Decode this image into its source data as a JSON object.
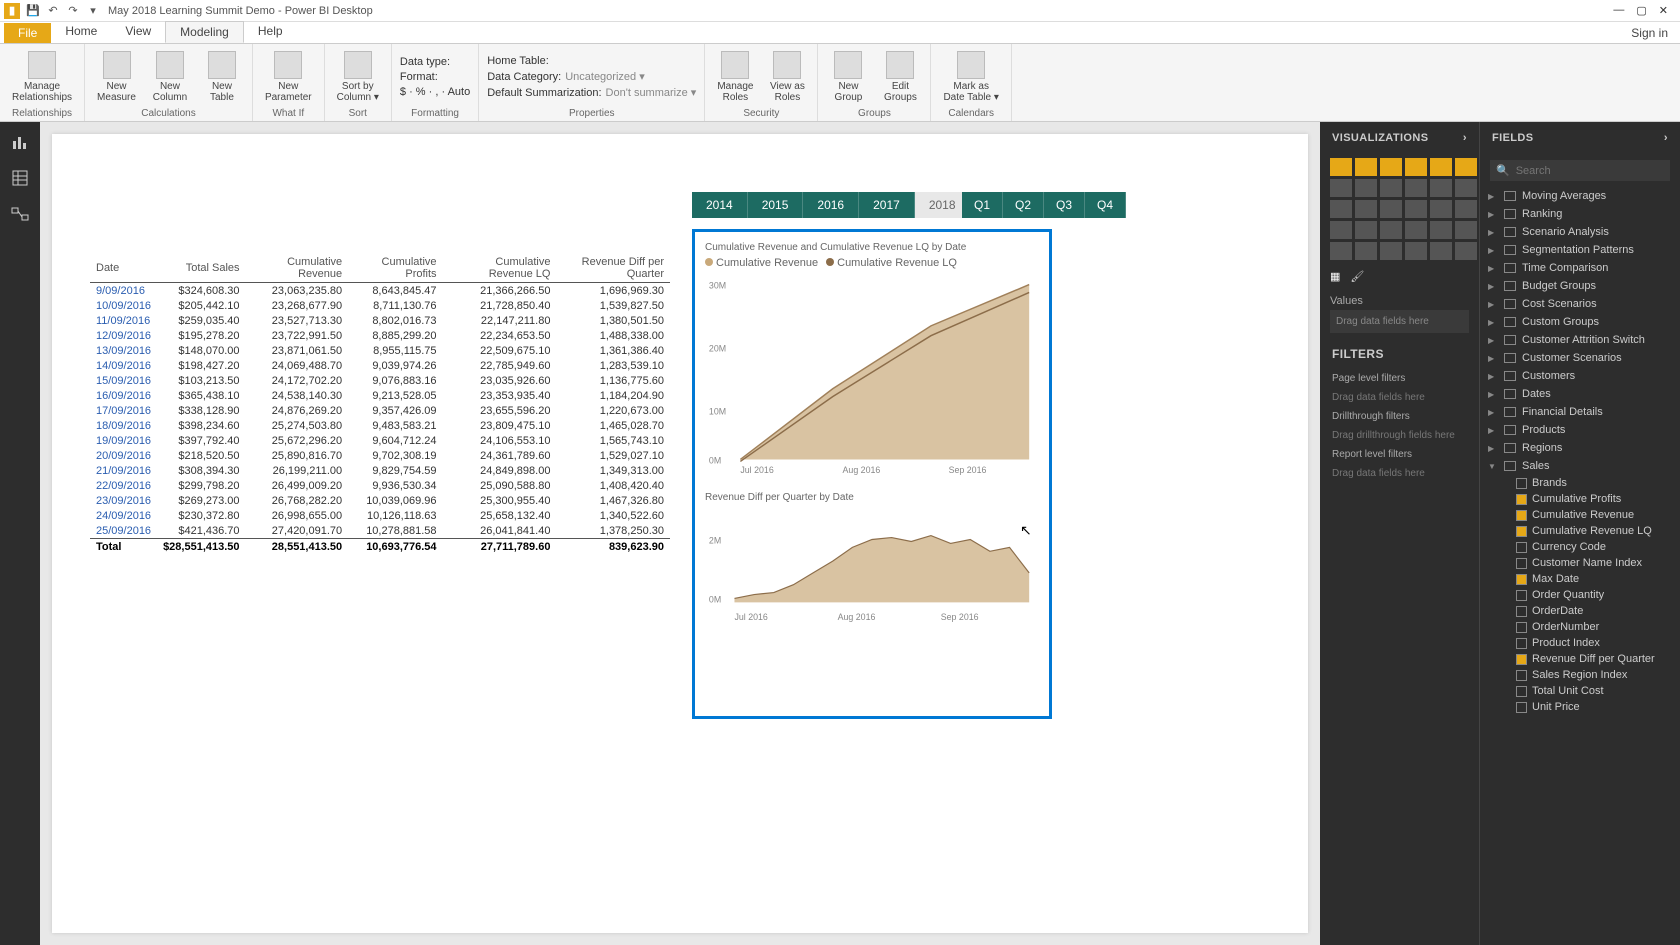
{
  "title": "May 2018 Learning Summit Demo - Power BI Desktop",
  "tabs": {
    "file": "File",
    "items": [
      "Home",
      "View",
      "Modeling",
      "Help"
    ],
    "active": "Modeling",
    "signin": "Sign in"
  },
  "ribbon": {
    "groups": [
      {
        "label": "Relationships",
        "buttons": [
          {
            "t": "Manage\nRelationships"
          }
        ]
      },
      {
        "label": "Calculations",
        "buttons": [
          {
            "t": "New\nMeasure"
          },
          {
            "t": "New\nColumn"
          },
          {
            "t": "New\nTable"
          }
        ]
      },
      {
        "label": "What If",
        "buttons": [
          {
            "t": "New\nParameter"
          }
        ]
      },
      {
        "label": "Sort",
        "buttons": [
          {
            "t": "Sort by\nColumn ▾"
          }
        ]
      },
      {
        "label": "Formatting",
        "rows": [
          {
            "l": "Data type:",
            "v": ""
          },
          {
            "l": "Format:",
            "v": ""
          },
          {
            "l2": "$ · % · , · Auto"
          }
        ]
      },
      {
        "label": "Properties",
        "rows": [
          {
            "l": "Home Table:",
            "v": ""
          },
          {
            "l": "Data Category:",
            "v": "Uncategorized ▾"
          },
          {
            "l": "Default Summarization:",
            "v": "Don't summarize ▾"
          }
        ]
      },
      {
        "label": "Security",
        "buttons": [
          {
            "t": "Manage\nRoles"
          },
          {
            "t": "View as\nRoles"
          }
        ]
      },
      {
        "label": "Groups",
        "buttons": [
          {
            "t": "New\nGroup"
          },
          {
            "t": "Edit\nGroups"
          }
        ]
      },
      {
        "label": "Calendars",
        "buttons": [
          {
            "t": "Mark as\nDate Table ▾"
          }
        ]
      }
    ]
  },
  "slicers": {
    "years": [
      "2014",
      "2015",
      "2016",
      "2017",
      "2018"
    ],
    "yearOff": "2018",
    "quarters": [
      "Q1",
      "Q2",
      "Q3",
      "Q4"
    ]
  },
  "table": {
    "headers": [
      "Date",
      "Total Sales",
      "Cumulative Revenue",
      "Cumulative Profits",
      "Cumulative Revenue LQ",
      "Revenue Diff per Quarter"
    ],
    "rows": [
      [
        "9/09/2016",
        "$324,608.30",
        "23,063,235.80",
        "8,643,845.47",
        "21,366,266.50",
        "1,696,969.30"
      ],
      [
        "10/09/2016",
        "$205,442.10",
        "23,268,677.90",
        "8,711,130.76",
        "21,728,850.40",
        "1,539,827.50"
      ],
      [
        "11/09/2016",
        "$259,035.40",
        "23,527,713.30",
        "8,802,016.73",
        "22,147,211.80",
        "1,380,501.50"
      ],
      [
        "12/09/2016",
        "$195,278.20",
        "23,722,991.50",
        "8,885,299.20",
        "22,234,653.50",
        "1,488,338.00"
      ],
      [
        "13/09/2016",
        "$148,070.00",
        "23,871,061.50",
        "8,955,115.75",
        "22,509,675.10",
        "1,361,386.40"
      ],
      [
        "14/09/2016",
        "$198,427.20",
        "24,069,488.70",
        "9,039,974.26",
        "22,785,949.60",
        "1,283,539.10"
      ],
      [
        "15/09/2016",
        "$103,213.50",
        "24,172,702.20",
        "9,076,883.16",
        "23,035,926.60",
        "1,136,775.60"
      ],
      [
        "16/09/2016",
        "$365,438.10",
        "24,538,140.30",
        "9,213,528.05",
        "23,353,935.40",
        "1,184,204.90"
      ],
      [
        "17/09/2016",
        "$338,128.90",
        "24,876,269.20",
        "9,357,426.09",
        "23,655,596.20",
        "1,220,673.00"
      ],
      [
        "18/09/2016",
        "$398,234.60",
        "25,274,503.80",
        "9,483,583.21",
        "23,809,475.10",
        "1,465,028.70"
      ],
      [
        "19/09/2016",
        "$397,792.40",
        "25,672,296.20",
        "9,604,712.24",
        "24,106,553.10",
        "1,565,743.10"
      ],
      [
        "20/09/2016",
        "$218,520.50",
        "25,890,816.70",
        "9,702,308.19",
        "24,361,789.60",
        "1,529,027.10"
      ],
      [
        "21/09/2016",
        "$308,394.30",
        "26,199,211.00",
        "9,829,754.59",
        "24,849,898.00",
        "1,349,313.00"
      ],
      [
        "22/09/2016",
        "$299,798.20",
        "26,499,009.20",
        "9,936,530.34",
        "25,090,588.80",
        "1,408,420.40"
      ],
      [
        "23/09/2016",
        "$269,273.00",
        "26,768,282.20",
        "10,039,069.96",
        "25,300,955.40",
        "1,467,326.80"
      ],
      [
        "24/09/2016",
        "$230,372.80",
        "26,998,655.00",
        "10,126,118.63",
        "25,658,132.40",
        "1,340,522.60"
      ],
      [
        "25/09/2016",
        "$421,436.70",
        "27,420,091.70",
        "10,278,881.58",
        "26,041,841.40",
        "1,378,250.30"
      ]
    ],
    "total": [
      "Total",
      "$28,551,413.50",
      "28,551,413.50",
      "10,693,776.54",
      "27,711,789.60",
      "839,623.90"
    ]
  },
  "chart1": {
    "title": "Cumulative Revenue and Cumulative Revenue LQ by Date",
    "legend": [
      "Cumulative Revenue",
      "Cumulative Revenue LQ"
    ],
    "yticks": [
      "30M",
      "20M",
      "10M",
      "0M"
    ],
    "xticks": [
      "Jul 2016",
      "Aug 2016",
      "Sep 2016"
    ]
  },
  "chart2": {
    "title": "Revenue Diff per Quarter by Date",
    "yticks": [
      "2M",
      "0M"
    ],
    "xticks": [
      "Jul 2016",
      "Aug 2016",
      "Sep 2016"
    ]
  },
  "vizPane": {
    "header": "VISUALIZATIONS",
    "values": "Values",
    "valuesDrop": "Drag data fields here",
    "filtersHdr": "FILTERS",
    "filters": [
      {
        "l": "Page level filters",
        "d": "Drag data fields here"
      },
      {
        "l": "Drillthrough filters",
        "d": "Drag drillthrough fields here"
      },
      {
        "l": "Report level filters",
        "d": "Drag data fields here"
      }
    ]
  },
  "fieldsPane": {
    "header": "FIELDS",
    "search": "Search",
    "tables": [
      {
        "n": "Moving Averages"
      },
      {
        "n": "Ranking"
      },
      {
        "n": "Scenario Analysis"
      },
      {
        "n": "Segmentation Patterns"
      },
      {
        "n": "Time Comparison"
      },
      {
        "n": "Budget Groups"
      },
      {
        "n": "Cost Scenarios"
      },
      {
        "n": "Custom Groups"
      },
      {
        "n": "Customer Attrition Switch"
      },
      {
        "n": "Customer Scenarios"
      },
      {
        "n": "Customers"
      },
      {
        "n": "Dates"
      },
      {
        "n": "Financial Details"
      },
      {
        "n": "Products"
      },
      {
        "n": "Regions"
      },
      {
        "n": "Sales",
        "open": true,
        "fields": [
          {
            "n": "Brands"
          },
          {
            "n": "Cumulative Profits",
            "c": true
          },
          {
            "n": "Cumulative Revenue",
            "c": true
          },
          {
            "n": "Cumulative Revenue LQ",
            "c": true
          },
          {
            "n": "Currency Code"
          },
          {
            "n": "Customer Name Index"
          },
          {
            "n": "Max Date",
            "c": true
          },
          {
            "n": "Order Quantity"
          },
          {
            "n": "OrderDate"
          },
          {
            "n": "OrderNumber"
          },
          {
            "n": "Product Index"
          },
          {
            "n": "Revenue Diff per Quarter",
            "c": true
          },
          {
            "n": "Sales Region Index"
          },
          {
            "n": "Total Unit Cost"
          },
          {
            "n": "Unit Price"
          }
        ]
      }
    ]
  },
  "chart_data": [
    {
      "type": "area",
      "title": "Cumulative Revenue and Cumulative Revenue LQ by Date",
      "ylabel": "",
      "ylim": [
        0,
        30000000
      ],
      "x": [
        "2016-07-01",
        "2016-08-01",
        "2016-09-01",
        "2016-09-30"
      ],
      "series": [
        {
          "name": "Cumulative Revenue",
          "values": [
            1000000,
            11000000,
            20000000,
            28551413
          ]
        },
        {
          "name": "Cumulative Revenue LQ",
          "values": [
            0,
            10000000,
            19000000,
            27711790
          ]
        }
      ]
    },
    {
      "type": "area",
      "title": "Revenue Diff per Quarter by Date",
      "ylabel": "",
      "ylim": [
        0,
        2500000
      ],
      "x": [
        "2016-07-01",
        "2016-08-01",
        "2016-09-01",
        "2016-09-30"
      ],
      "series": [
        {
          "name": "Revenue Diff per Quarter",
          "values": [
            300000,
            1500000,
            1800000,
            839624
          ]
        }
      ]
    }
  ]
}
